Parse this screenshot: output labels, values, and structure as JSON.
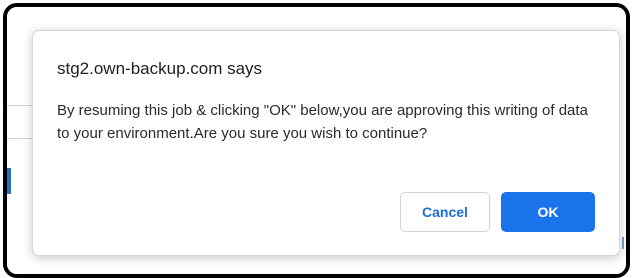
{
  "dialog": {
    "title": "stg2.own-backup.com says",
    "message": "By resuming this job & clicking \"OK\" below,you are approving this writing of data to your environment.Are you sure you wish to continue?",
    "cancel_label": "Cancel",
    "ok_label": "OK"
  },
  "colors": {
    "primary_button": "#1a73e8",
    "cancel_text": "#1a6fd8",
    "frame_border": "#000000"
  }
}
